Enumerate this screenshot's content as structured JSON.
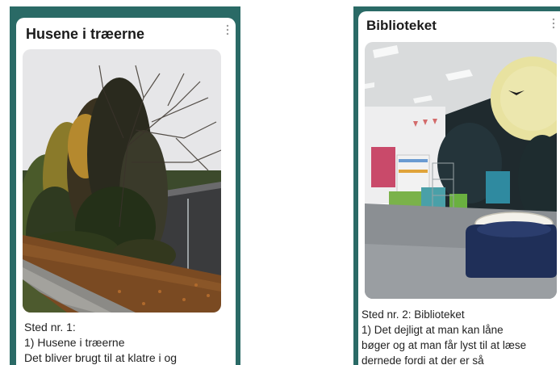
{
  "cards": [
    {
      "title": "Husene i træerne",
      "menu_icon": "more-vertical-icon",
      "photo": "trees-photo",
      "caption_lines": [
        "Sted nr. 1:",
        " 1) Husene i træerne",
        " Det bliver brugt til at klatre i og"
      ]
    },
    {
      "title": "Biblioteket",
      "menu_icon": "more-vertical-icon",
      "photo": "library-photo",
      "caption_lines": [
        "Sted nr. 2: Biblioteket",
        " 1) Det dejligt at man kan låne",
        "bøger og at man får lyst til at læse",
        "dernede fordi at der er så"
      ]
    }
  ],
  "colors": {
    "frame": "#2a6a66",
    "card": "#ffffff",
    "text": "#222222"
  }
}
